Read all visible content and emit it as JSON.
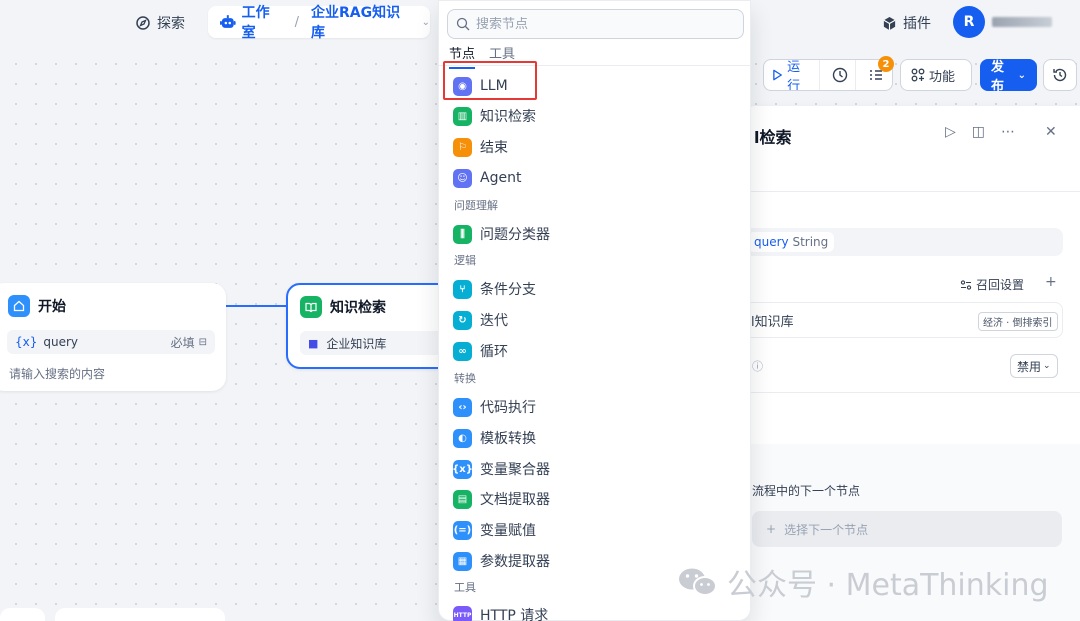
{
  "topbar": {
    "explore_label": "探索",
    "studio_label": "工作室",
    "breadcrumb_sep": "/",
    "app_name": "企业RAG知识库",
    "plugin_label": "插件",
    "avatar_initial": "R"
  },
  "toolbar": {
    "run_label": "运行",
    "checklist_badge": "2",
    "features_label": "功能",
    "publish_label": "发布"
  },
  "nodes": {
    "start": {
      "title": "开始",
      "var_icon": "{x}",
      "var_name": "query",
      "required": "必填",
      "hint": "请输入搜索的内容"
    },
    "knowledge": {
      "title": "知识检索",
      "dataset": "企业知识库"
    }
  },
  "panel": {
    "title_partial": "l检索",
    "query_var": "query",
    "query_type": "String",
    "recall_label": "召回设置",
    "kb_name": "l知识库",
    "kb_tag": "经济 · 倒排索引",
    "disable_label": "禁用",
    "next_hint": "流程中的下一个节点",
    "next_btn": "选择下一个节点"
  },
  "popup": {
    "search_placeholder": "搜索节点",
    "tabs": [
      "节点",
      "工具"
    ],
    "items": [
      {
        "label": "LLM",
        "icon": "llm-icon",
        "color": "#6172f3"
      },
      {
        "label": "知识检索",
        "icon": "knowledge-icon",
        "color": "#16b364"
      },
      {
        "label": "结束",
        "icon": "end-icon",
        "color": "#f79009"
      },
      {
        "label": "Agent",
        "icon": "agent-icon",
        "color": "#6172f3"
      },
      {
        "label": "问题分类器",
        "icon": "classifier-icon",
        "color": "#16b364"
      },
      {
        "label": "条件分支",
        "icon": "if-else-icon",
        "color": "#06aed4"
      },
      {
        "label": "迭代",
        "icon": "iteration-icon",
        "color": "#06aed4"
      },
      {
        "label": "循环",
        "icon": "loop-icon",
        "color": "#06aed4"
      },
      {
        "label": "代码执行",
        "icon": "code-icon",
        "color": "#2e90fa"
      },
      {
        "label": "模板转换",
        "icon": "template-icon",
        "color": "#2e90fa"
      },
      {
        "label": "变量聚合器",
        "icon": "variable-aggregator-icon",
        "color": "#2e90fa"
      },
      {
        "label": "文档提取器",
        "icon": "doc-extractor-icon",
        "color": "#16b364"
      },
      {
        "label": "变量赋值",
        "icon": "assigner-icon",
        "color": "#2e90fa"
      },
      {
        "label": "参数提取器",
        "icon": "parameter-extractor-icon",
        "color": "#2e90fa"
      },
      {
        "label": "HTTP 请求",
        "icon": "http-icon",
        "color": "#7a5af8"
      }
    ],
    "categories": [
      "问题理解",
      "逻辑",
      "转换",
      "工具"
    ]
  },
  "watermark": {
    "text": "公众号 · MetaThinking"
  }
}
